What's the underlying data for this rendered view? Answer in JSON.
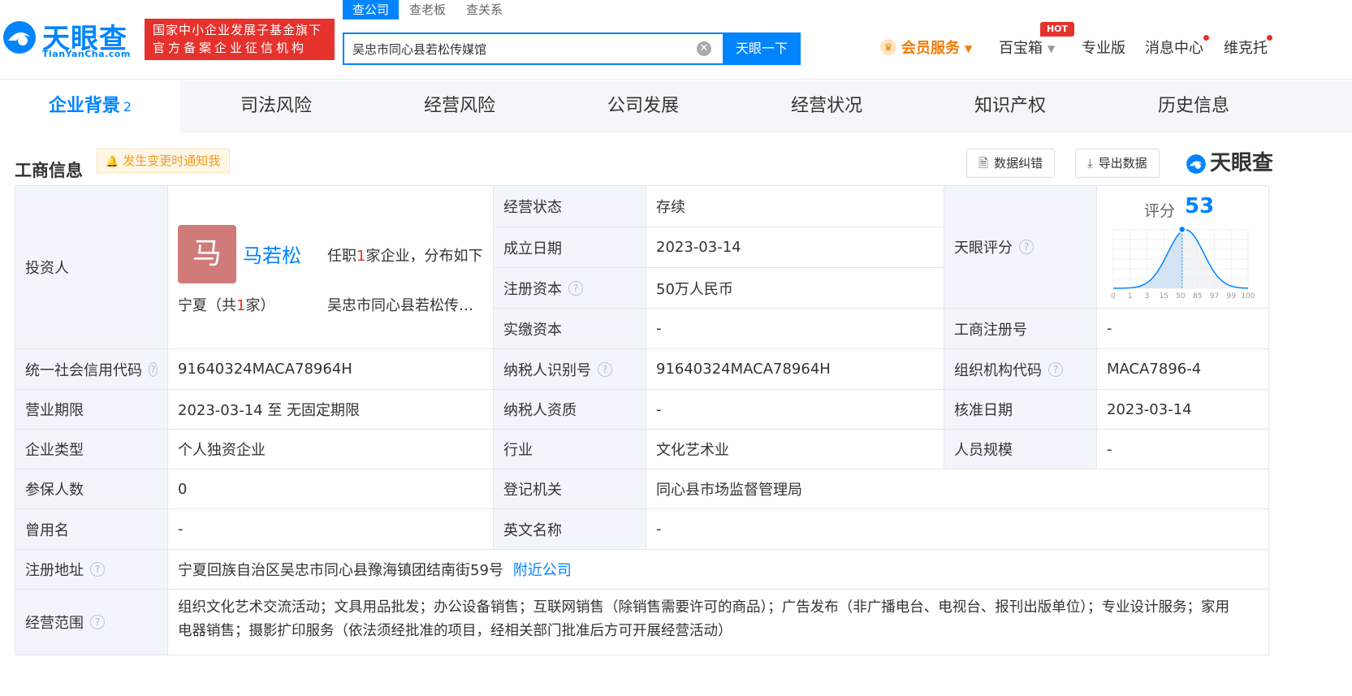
{
  "header": {
    "logo_cn": "天眼查",
    "logo_en": "TianYanCha.com",
    "gov_line1": "国家中小企业发展子基金旗下",
    "gov_line2": "官方备案企业征信机构",
    "search_tabs": [
      "查公司",
      "查老板",
      "查关系"
    ],
    "search_value": "吴忠市同心县若松传媒馆",
    "search_button": "天眼一下",
    "nav": {
      "vip": "会员服务",
      "toolbox": "百宝箱",
      "hot": "HOT",
      "pro": "专业版",
      "messages": "消息中心",
      "user": "维克托"
    }
  },
  "tabs": [
    {
      "label": "企业背景",
      "count": "2"
    },
    {
      "label": "司法风险"
    },
    {
      "label": "经营风险"
    },
    {
      "label": "公司发展"
    },
    {
      "label": "经营状况"
    },
    {
      "label": "知识产权"
    },
    {
      "label": "历史信息"
    }
  ],
  "section": {
    "title": "工商信息",
    "notify": "发生变更时通知我",
    "correct_btn": "数据纠错",
    "export_btn": "导出数据",
    "brand": "天眼查"
  },
  "investor": {
    "label": "投资人",
    "avatar_char": "马",
    "name": "马若松",
    "desc_prefix": "任职",
    "desc_count": "1",
    "desc_suffix": "家企业，分布如下",
    "region_prefix": "宁夏（共",
    "region_count": "1",
    "region_suffix": "家）",
    "company": "吴忠市同心县若松传媒馆"
  },
  "fields": {
    "status_label": "经营状态",
    "status": "存续",
    "est_label": "成立日期",
    "est": "2023-03-14",
    "capital_label": "注册资本",
    "capital": "50万人民币",
    "paid_label": "实缴资本",
    "paid": "-",
    "score_label": "天眼评分",
    "score_title": "评分",
    "score": 53,
    "score_axis": [
      "0",
      "1",
      "3",
      "15",
      "50",
      "85",
      "97",
      "99",
      "100"
    ],
    "regno_label": "工商注册号",
    "regno": "-",
    "credit_label": "统一社会信用代码",
    "credit": "91640324MACA78964H",
    "taxid_label": "纳税人识别号",
    "taxid": "91640324MACA78964H",
    "org_label": "组织机构代码",
    "org": "MACA7896-4",
    "term_label": "营业期限",
    "term": "2023-03-14 至 无固定期限",
    "taxq_label": "纳税人资质",
    "taxq": "-",
    "approve_label": "核准日期",
    "approve": "2023-03-14",
    "type_label": "企业类型",
    "type": "个人独资企业",
    "industry_label": "行业",
    "industry": "文化艺术业",
    "staff_label": "人员规模",
    "staff": "-",
    "insured_label": "参保人数",
    "insured": "0",
    "authority_label": "登记机关",
    "authority": "同心县市场监督管理局",
    "former_label": "曾用名",
    "former": "-",
    "en_label": "英文名称",
    "en": "-",
    "address_label": "注册地址",
    "address": "宁夏回族自治区吴忠市同心县豫海镇团结南街59号",
    "nearby": "附近公司",
    "scope_label": "经营范围",
    "scope_line1": "组织文化艺术交流活动；文具用品批发；办公设备销售；互联网销售（除销售需要许可的商品）；广告发布（非广播电台、电视台、报刊出版单位）；专业设计服务；家用",
    "scope_line2": "电器销售；摄影扩印服务（依法须经批准的项目，经相关部门批准后方可开展经营活动）"
  },
  "colors": {
    "brand_blue": "#0084ff",
    "gov_red": "#e5322d",
    "vip_orange": "#f07c09",
    "label_bg": "#f2f6fc"
  }
}
